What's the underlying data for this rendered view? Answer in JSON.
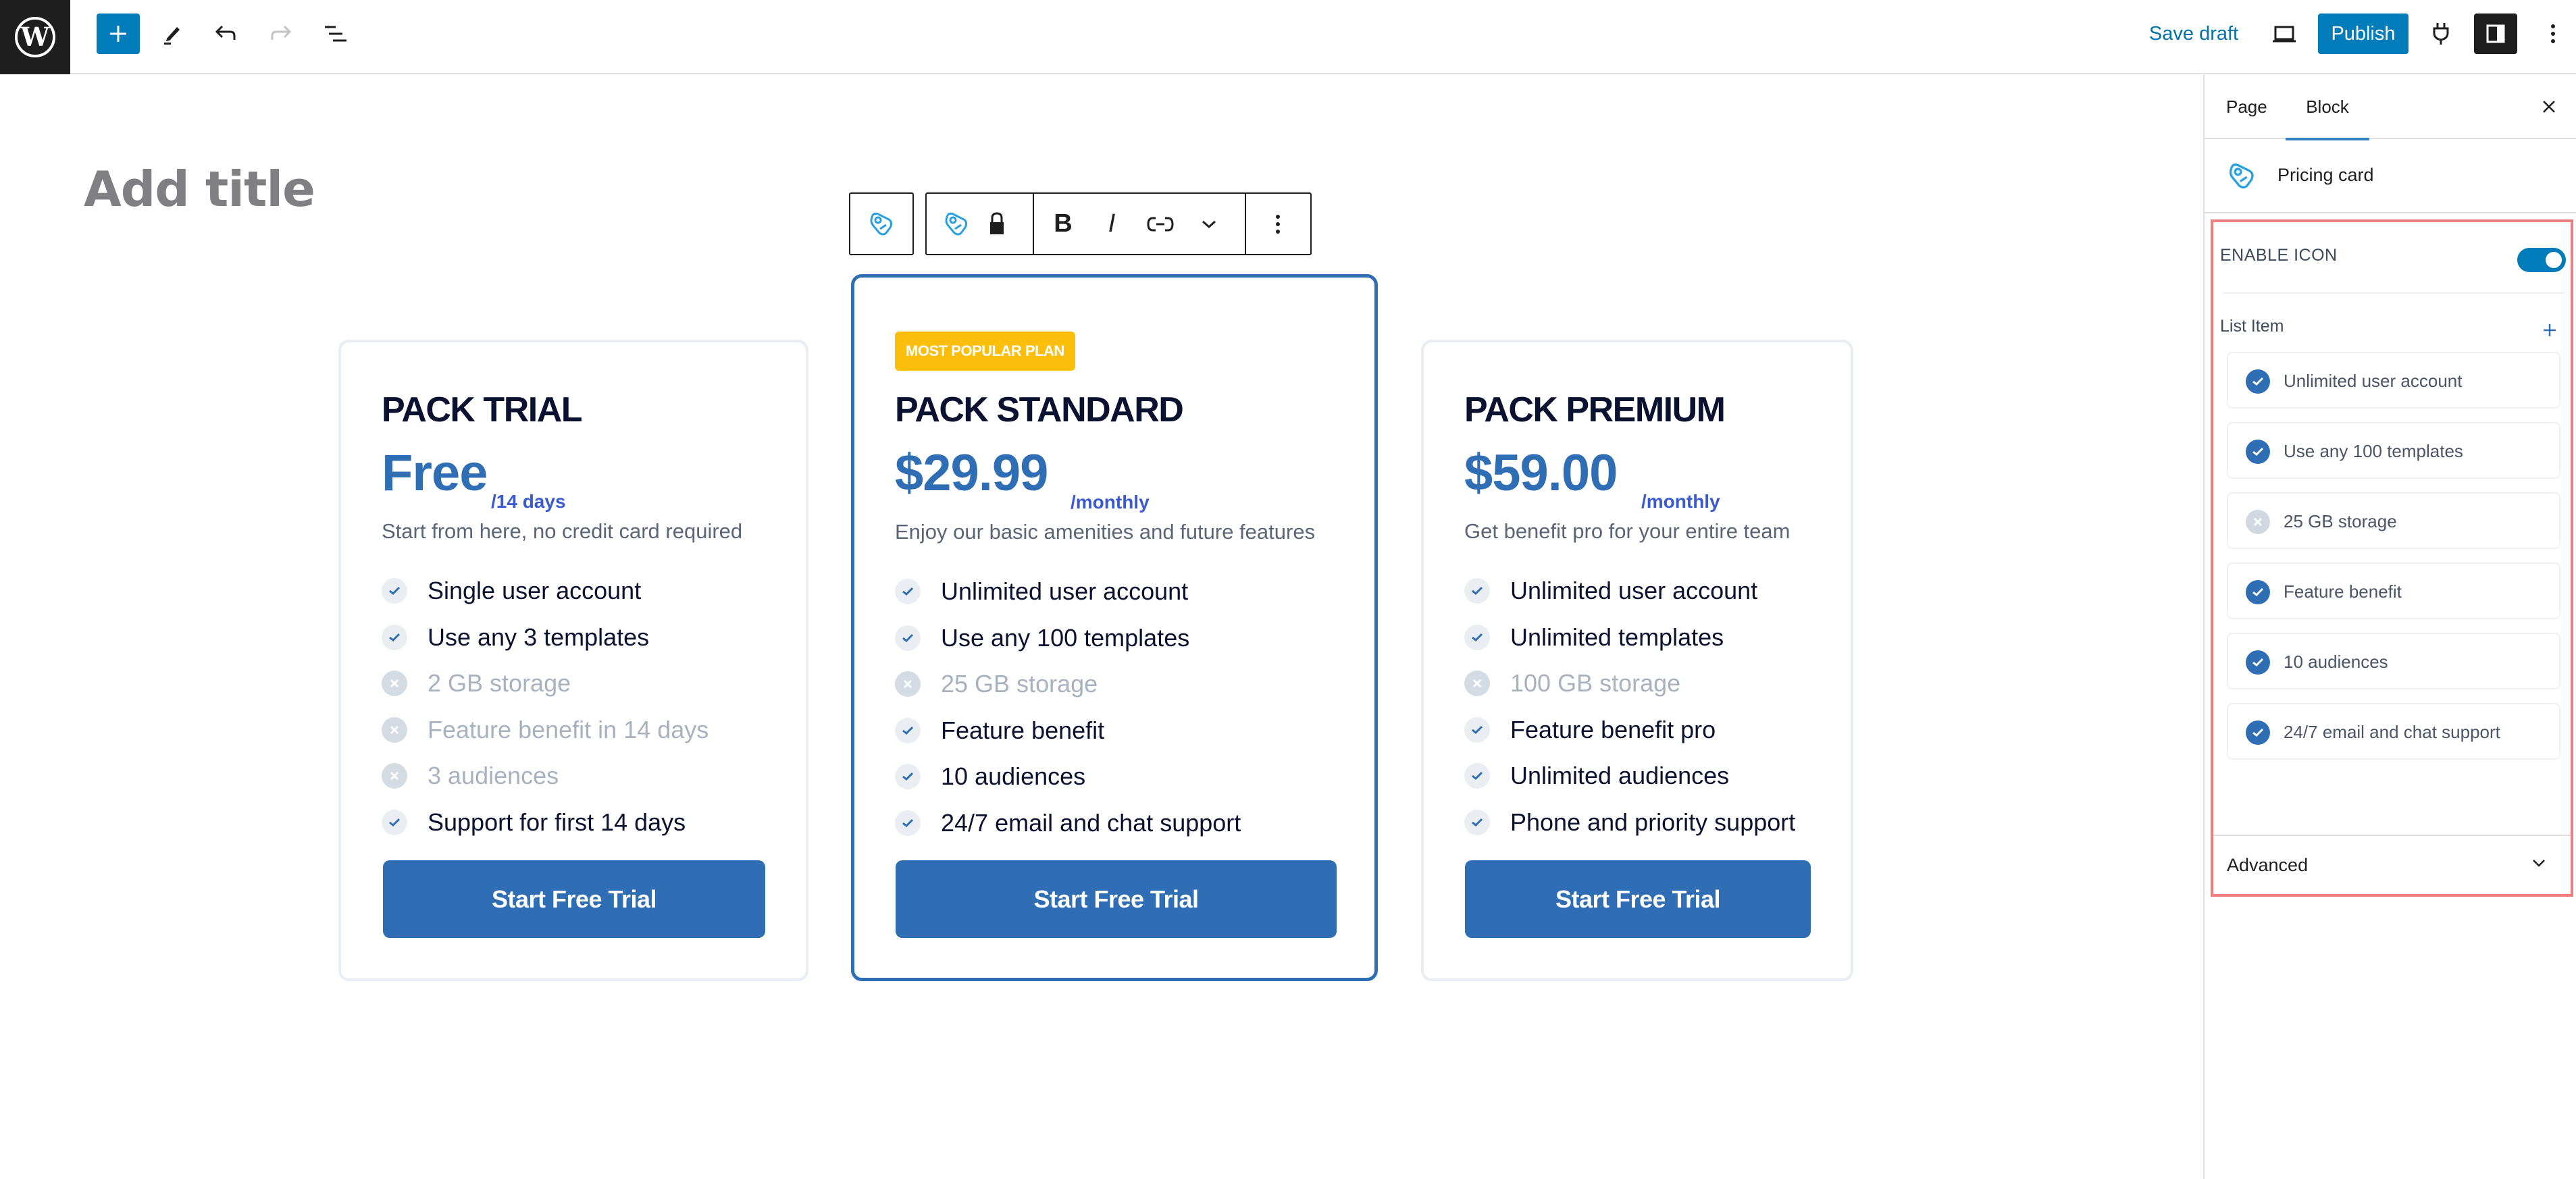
{
  "header": {
    "logo": "wordpress-logo",
    "inserter_label": "+",
    "save_draft": "Save draft",
    "publish": "Publish",
    "icons": [
      "plus-icon",
      "pencil-icon",
      "undo-icon",
      "redo-icon",
      "list-view-icon",
      "laptop-preview-icon",
      "plug-icon",
      "sidebar-toggle-icon",
      "kebab-menu-icon"
    ]
  },
  "editor": {
    "title_placeholder": "Add title"
  },
  "block_toolbar": {
    "parent_icon": "tag-icon",
    "block_icon": "tag-icon",
    "lock_icon": "lock-icon",
    "bold": "B",
    "italic": "I",
    "link_icon": "link-icon",
    "more_icon": "chevron-down-icon",
    "options_icon": "kebab-icon"
  },
  "cards": [
    {
      "name": "PACK TRIAL",
      "price": "Free",
      "period": "/14 days",
      "description": "Start from here, no credit card required",
      "features": [
        {
          "text": "Single user account",
          "enabled": true
        },
        {
          "text": "Use any 3 templates",
          "enabled": true
        },
        {
          "text": "2 GB storage",
          "enabled": false
        },
        {
          "text": "Feature benefit in 14 days",
          "enabled": false
        },
        {
          "text": "3 audiences",
          "enabled": false
        },
        {
          "text": "Support for first 14 days",
          "enabled": true
        }
      ],
      "cta": "Start Free Trial"
    },
    {
      "badge": "MOST POPULAR PLAN",
      "name": "PACK STANDARD",
      "price": "$29.99",
      "period": "/monthly",
      "description": "Enjoy our basic amenities and future features",
      "features": [
        {
          "text": "Unlimited user account",
          "enabled": true
        },
        {
          "text": "Use any 100 templates",
          "enabled": true
        },
        {
          "text": "25 GB storage",
          "enabled": false
        },
        {
          "text": "Feature benefit",
          "enabled": true
        },
        {
          "text": "10 audiences",
          "enabled": true
        },
        {
          "text": "24/7 email and chat support",
          "enabled": true
        }
      ],
      "cta": "Start Free Trial"
    },
    {
      "name": "PACK PREMIUM",
      "price": "$59.00",
      "period": "/monthly",
      "description": "Get benefit pro for your entire team",
      "features": [
        {
          "text": "Unlimited user account",
          "enabled": true
        },
        {
          "text": "Unlimited templates",
          "enabled": true
        },
        {
          "text": "100 GB storage",
          "enabled": false
        },
        {
          "text": "Feature benefit pro",
          "enabled": true
        },
        {
          "text": "Unlimited audiences",
          "enabled": true
        },
        {
          "text": "Phone and priority support",
          "enabled": true
        }
      ],
      "cta": "Start Free Trial"
    }
  ],
  "sidebar": {
    "tabs": [
      {
        "label": "Page",
        "active": false
      },
      {
        "label": "Block",
        "active": true
      }
    ],
    "block_card": {
      "title": "Pricing card",
      "icon": "tag-icon"
    },
    "enable_icon": {
      "label": "ENABLE ICON",
      "checked": true
    },
    "list_item_label": "List Item",
    "list_items": [
      {
        "text": "Unlimited user account",
        "enabled": true
      },
      {
        "text": "Use any 100 templates",
        "enabled": true
      },
      {
        "text": "25 GB storage",
        "enabled": false
      },
      {
        "text": "Feature benefit",
        "enabled": true
      },
      {
        "text": "10 audiences",
        "enabled": true
      },
      {
        "text": "24/7 email and chat support",
        "enabled": true
      }
    ],
    "advanced_label": "Advanced"
  },
  "colors": {
    "wp_blue": "#007cba",
    "card_accent": "#2f6eb5",
    "badge": "#fbbf0b",
    "highlight_box": "#ef7e7e"
  }
}
